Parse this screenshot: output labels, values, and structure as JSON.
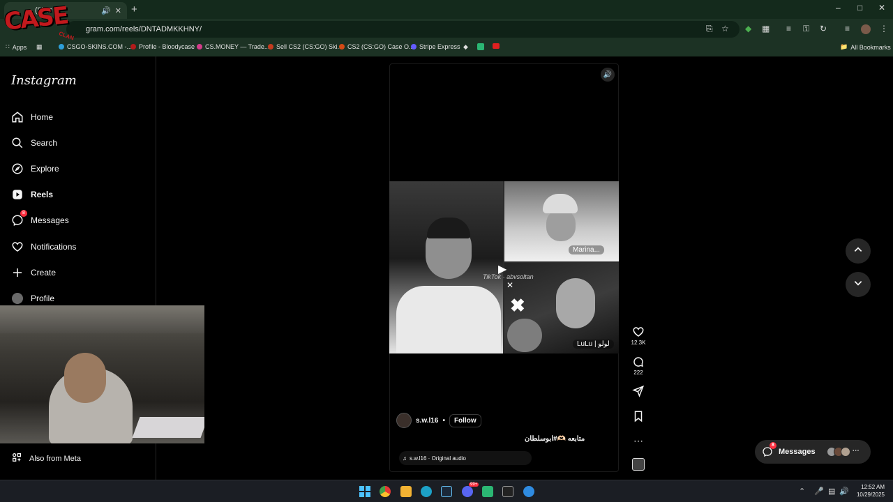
{
  "browser": {
    "tab_title": "(8) In",
    "url": "gram.com/reels/DNTADMKKHNY/",
    "bookmarks": [
      {
        "label": "Apps",
        "color": "#3b6bd1"
      },
      {
        "label": "CSGO-SKINS.COM -...",
        "color": "#2e9fd8"
      },
      {
        "label": "Profile - Bloodycase",
        "color": "#b31b1b"
      },
      {
        "label": "CS.MONEY — Trade...",
        "color": "#d43c8a"
      },
      {
        "label": "Sell CS2 (CS:GO) Ski...",
        "color": "#c43b1f"
      },
      {
        "label": "CS2 (CS:GO) Case O...",
        "color": "#d44a15"
      },
      {
        "label": "Stripe Express",
        "color": "#635bff"
      }
    ],
    "all_bookmarks": "All Bookmarks"
  },
  "overlay_logo": {
    "text": "CASE",
    "sub": "CLAN"
  },
  "sidebar": {
    "logo": "Instagram",
    "items": [
      {
        "label": "Home",
        "icon": "home-icon"
      },
      {
        "label": "Search",
        "icon": "search-icon"
      },
      {
        "label": "Explore",
        "icon": "compass-icon"
      },
      {
        "label": "Reels",
        "icon": "reels-icon"
      },
      {
        "label": "Messages",
        "icon": "messenger-icon",
        "badge": "8"
      },
      {
        "label": "Notifications",
        "icon": "heart-icon"
      },
      {
        "label": "Create",
        "icon": "plus-icon"
      },
      {
        "label": "Profile",
        "icon": "avatar"
      }
    ],
    "also_from_meta": "Also from Meta"
  },
  "reel": {
    "labels": {
      "marina": "Marina...",
      "lulu": "LuLu | لولو",
      "watermark": "TikTok · abvsoltan"
    },
    "author": "s.w.l16",
    "separator": "•",
    "follow": "Follow",
    "caption": "متابعه 🫶🏻#ابوسلطان",
    "audio": "s.w.l16 · Original audio",
    "likes": "12.3K",
    "comments": "222"
  },
  "messages_pill": {
    "label": "Messages",
    "badge": "8"
  },
  "taskbar": {
    "time": "12:52 AM",
    "date": "10/29/2025",
    "discord_badge": "99+"
  },
  "colors": {
    "accent_red": "#ff3040",
    "bg": "#000000",
    "panel": "#262626"
  }
}
